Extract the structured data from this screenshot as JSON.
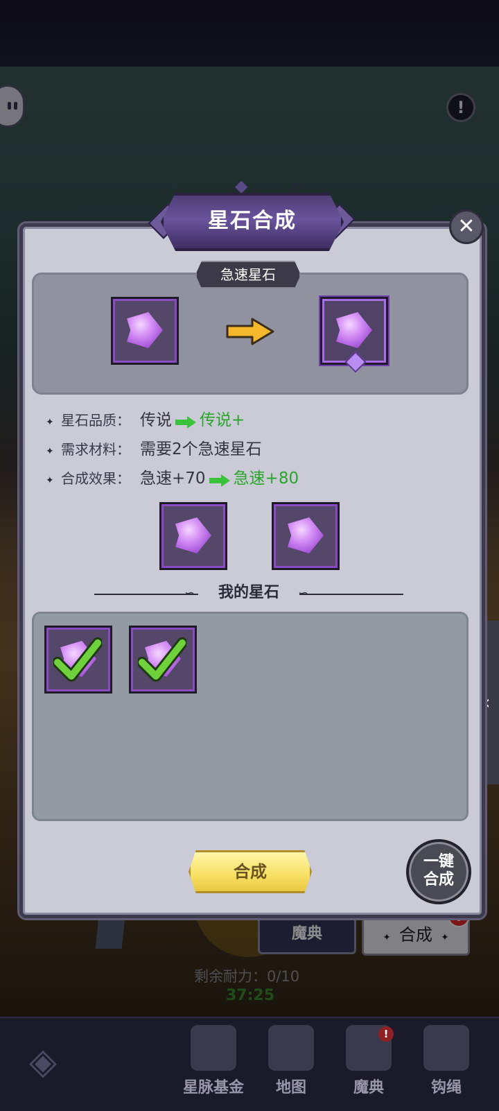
{
  "dialog": {
    "title": "星石合成",
    "recipe_name": "急速星石",
    "rows": [
      {
        "label": "星石品质：",
        "value": "传说",
        "new_value": "传说+"
      },
      {
        "label": "需求材料：",
        "value": "需要2个急速星石",
        "new_value": ""
      },
      {
        "label": "合成效果：",
        "value": "急速+70",
        "new_value": "急速+80"
      }
    ],
    "my_stones_title": "我的星石",
    "compose_label": "合成",
    "one_click_line1": "一键",
    "one_click_line2": "合成"
  },
  "background": {
    "warn_icon": "!",
    "book_button": "魔典",
    "compose_button": "合成",
    "badge": "!",
    "stamina": "剩余耐力：0/10",
    "timer": "37:25",
    "side_arrow": "‹"
  },
  "bottom_nav": {
    "items": [
      {
        "label": "星脉基金"
      },
      {
        "label": "地图"
      },
      {
        "label": "魔典",
        "badge": "!"
      },
      {
        "label": "钩绳"
      }
    ]
  },
  "colors": {
    "gem": "#c67ef0",
    "accent_green": "#2aa52a",
    "gold": "#f7df63"
  }
}
